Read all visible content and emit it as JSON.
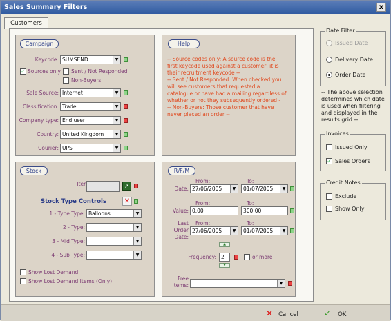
{
  "window": {
    "title": "Sales Summary Filters",
    "close_glyph": "x"
  },
  "tab": {
    "label": "Customers"
  },
  "campaign": {
    "title": "Campaign",
    "keycode_label": "Keycode:",
    "keycode_value": "SUMSEND",
    "sources_only": "Sources only",
    "sent_not_responded": "Sent / Not Responded",
    "non_buyers": "Non-Buyers",
    "sale_source_label": "Sale Source:",
    "sale_source_value": "Internet",
    "classification_label": "Classification:",
    "classification_value": "Trade",
    "company_type_label": "Company type:",
    "company_type_value": "End user",
    "country_label": "Country:",
    "country_value": "United Kingdom",
    "courier_label": "Courier:",
    "courier_value": "UPS"
  },
  "help": {
    "title": "Help",
    "lines": [
      "-- Source codes only: A source code is the first keycode used against a customer, it is their recruitment keycode --",
      "-- Sent / Not Responded: When checked you will see customers that requested a catalogue or have had a mailing regardless of whether or not they subsequently ordered -",
      "-- Non-Buyers: Those customer that have never placed an order --"
    ]
  },
  "stock": {
    "title": "Stock",
    "item_label": "Item:",
    "controls_title": "Stock Type Controls",
    "type1_label": "1 - Type Type:",
    "type1_value": "Balloons",
    "type2_label": "2 - Type:",
    "type3_label": "3 - Mid Type:",
    "type4_label": "4 - Sub Type:",
    "show_lost": "Show Lost Demand",
    "show_lost_only": "Show Lost Demand Items (Only)"
  },
  "rfm": {
    "title": "R/F/M",
    "from": "From:",
    "to": "To:",
    "date_label": "Date:",
    "date_from": "27/06/2005",
    "date_to": "01/07/2005",
    "value_label": "Value:",
    "value_from": "0.00",
    "value_to": "300.00",
    "last_order_label_1": "Last",
    "last_order_label_2": "Order",
    "last_order_label_3": "Date:",
    "last_from": "27/06/2005",
    "last_to": "01/07/2005",
    "frequency_label": "Frequency:",
    "frequency_value": "2",
    "or_more": "or more",
    "free_items_label_1": "Free",
    "free_items_label_2": "Items:"
  },
  "date_filter": {
    "title": "Date Filter",
    "issued_date": "Issued Date",
    "delivery_date": "Delivery Date",
    "order_date": "Order Date",
    "note": "-- The above selection determines which date is used when filtering and displayed in the results grid --"
  },
  "invoices": {
    "title": "Invoices",
    "issued_only": "Issued Only",
    "sales_orders": "Sales Orders"
  },
  "credit_notes": {
    "title": "Credit Notes",
    "exclude": "Exclude",
    "show_only": "Show Only"
  },
  "footer": {
    "cancel": "Cancel",
    "ok": "OK"
  }
}
